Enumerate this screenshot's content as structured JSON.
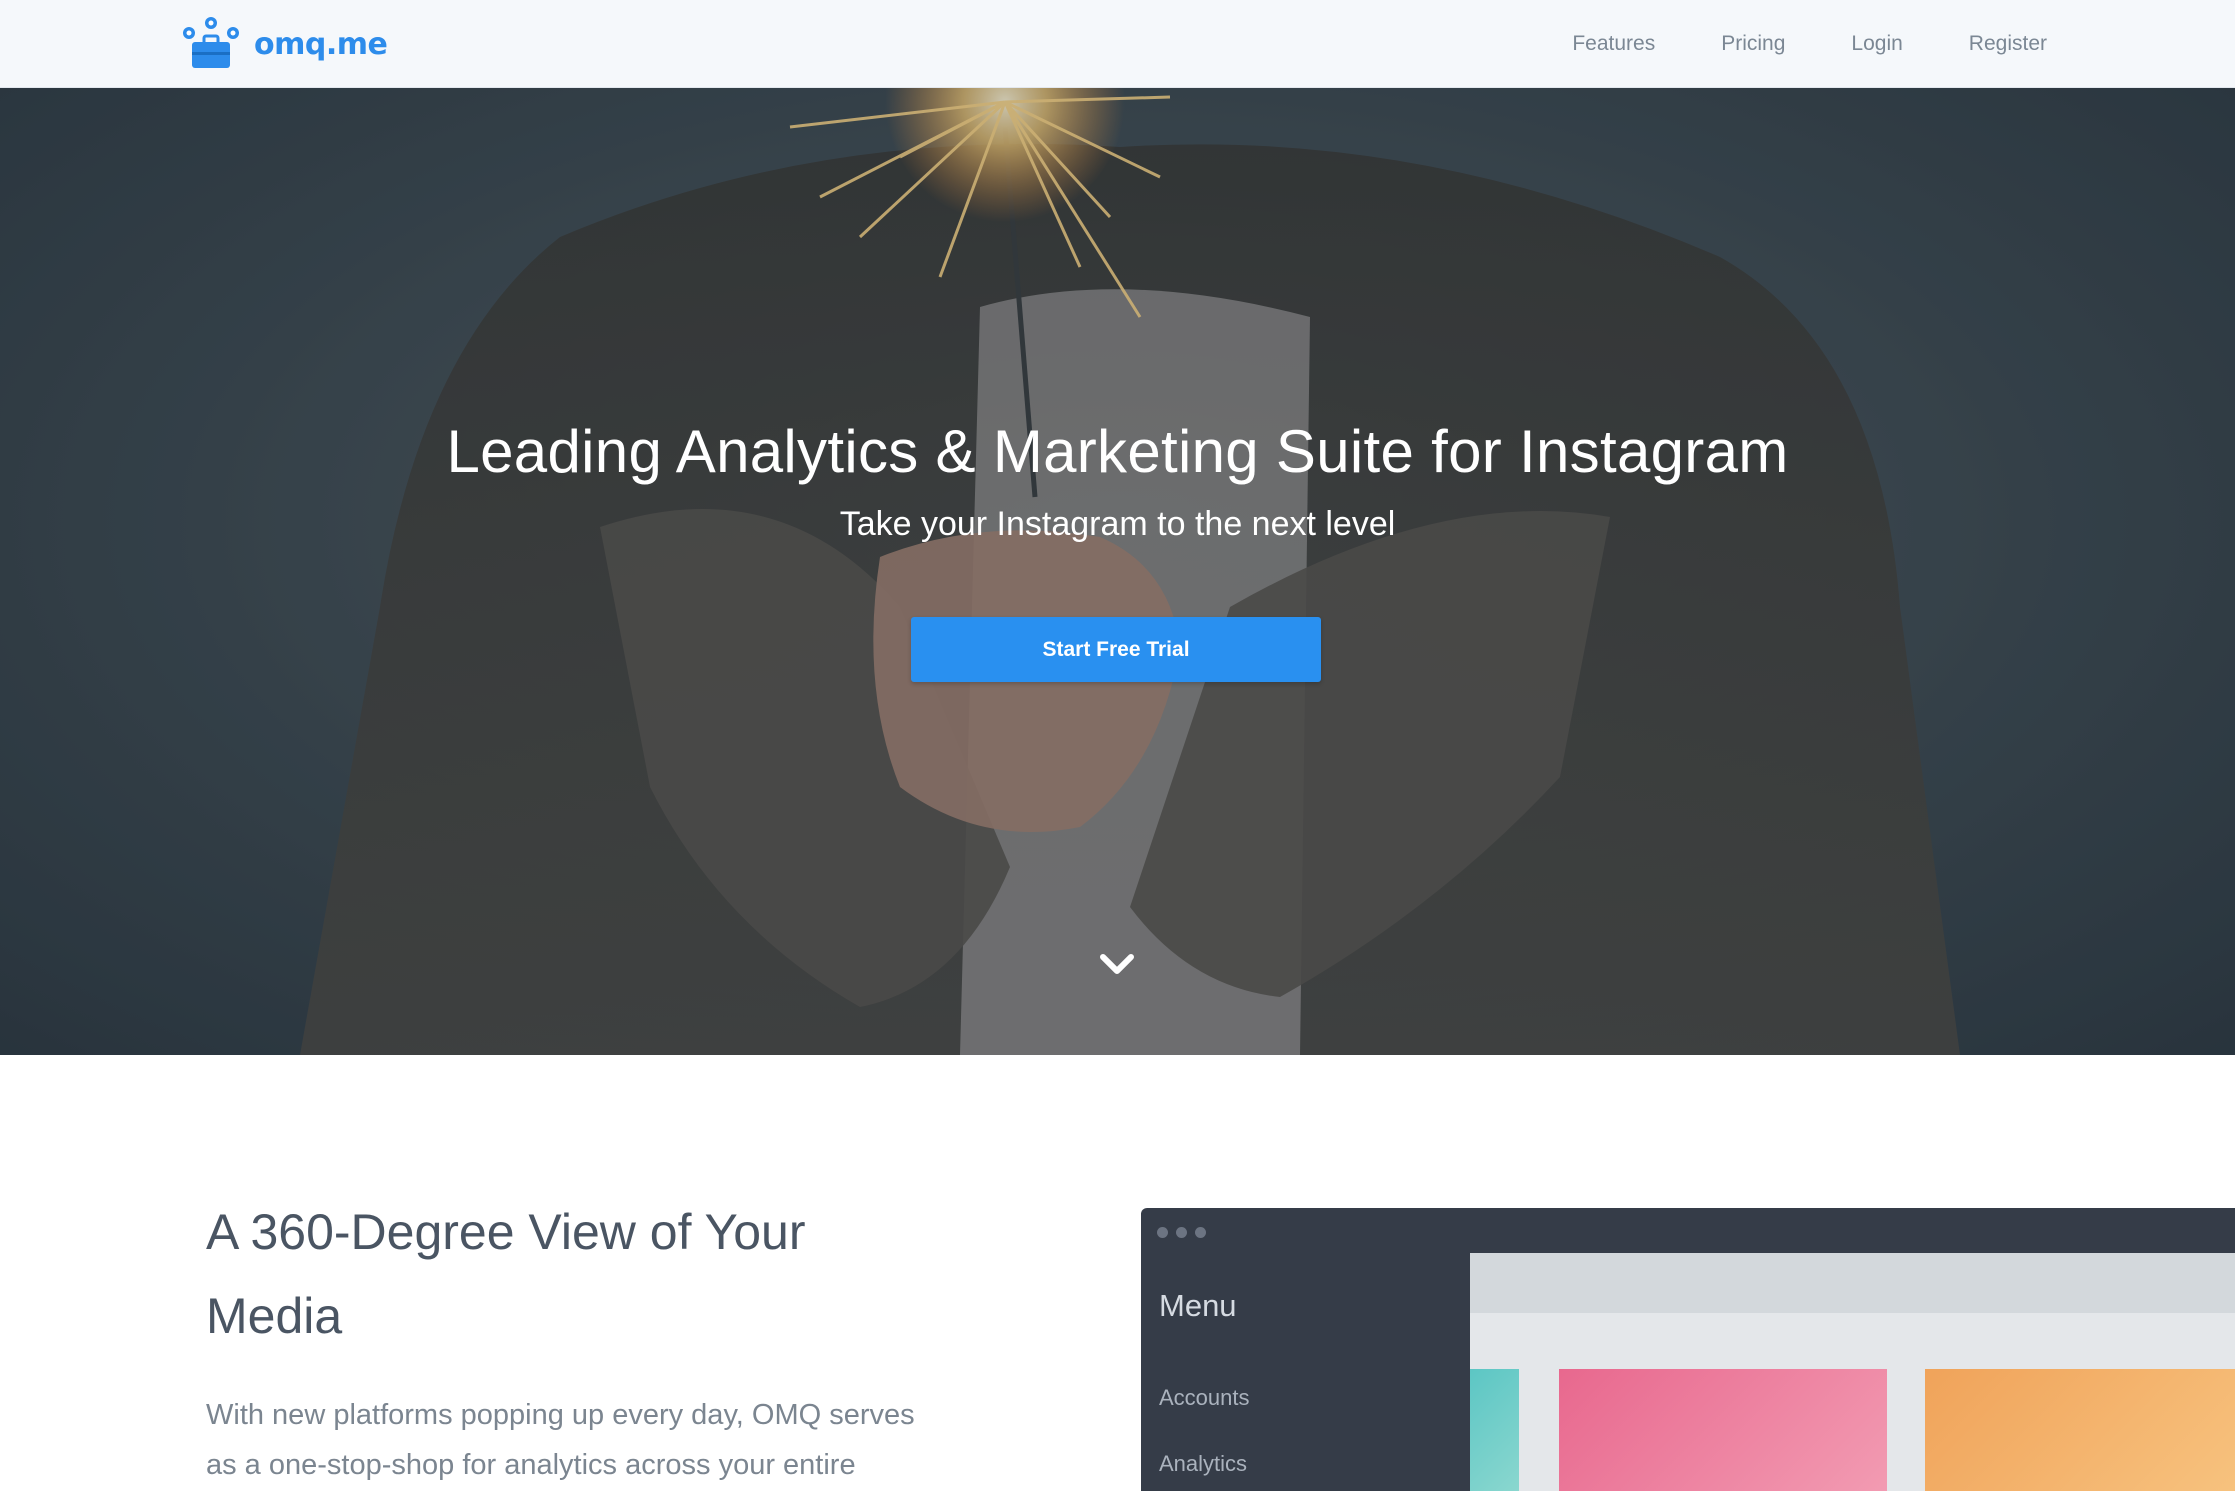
{
  "brand": {
    "name": "omq.me",
    "logo_icon": "briefcase-bubbles-icon",
    "color": "#2d8ceb"
  },
  "nav": {
    "items": [
      "Features",
      "Pricing",
      "Login",
      "Register"
    ]
  },
  "hero": {
    "title": "Leading Analytics & Marketing Suite for Instagram",
    "subtitle": "Take your Instagram to the next level",
    "cta_label": "Start Free Trial",
    "cta_color": "#2990f0",
    "scroll_icon": "chevron-down-icon"
  },
  "feature": {
    "title_line1": "A 360-Degree View of Your",
    "title_line2": "Media",
    "text_line1": "With new platforms popping up every day, OMQ serves",
    "text_line2": "as a one-stop-shop for analytics across your entire"
  },
  "mockup": {
    "menu_title": "Menu",
    "menu_items": [
      "Accounts",
      "Analytics"
    ]
  }
}
